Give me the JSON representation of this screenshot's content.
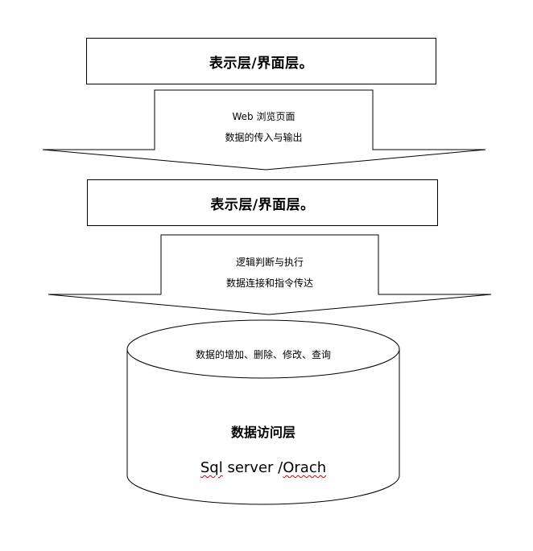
{
  "layers": {
    "presentation_top": "表示层/界面层。",
    "presentation_mid": "表示层/界面层。",
    "data_access": "数据访问层"
  },
  "arrows": {
    "first": {
      "line1": "Web 浏览页面",
      "line2": "数据的传入与输出"
    },
    "second": {
      "line1": "逻辑判断与执行",
      "line2": "数据连接和指令传达"
    }
  },
  "database": {
    "top_text": "数据的增加、删除、修改、查询",
    "sub_part1": "Sql",
    "sub_part2": " server /",
    "sub_part3": "Orach"
  }
}
